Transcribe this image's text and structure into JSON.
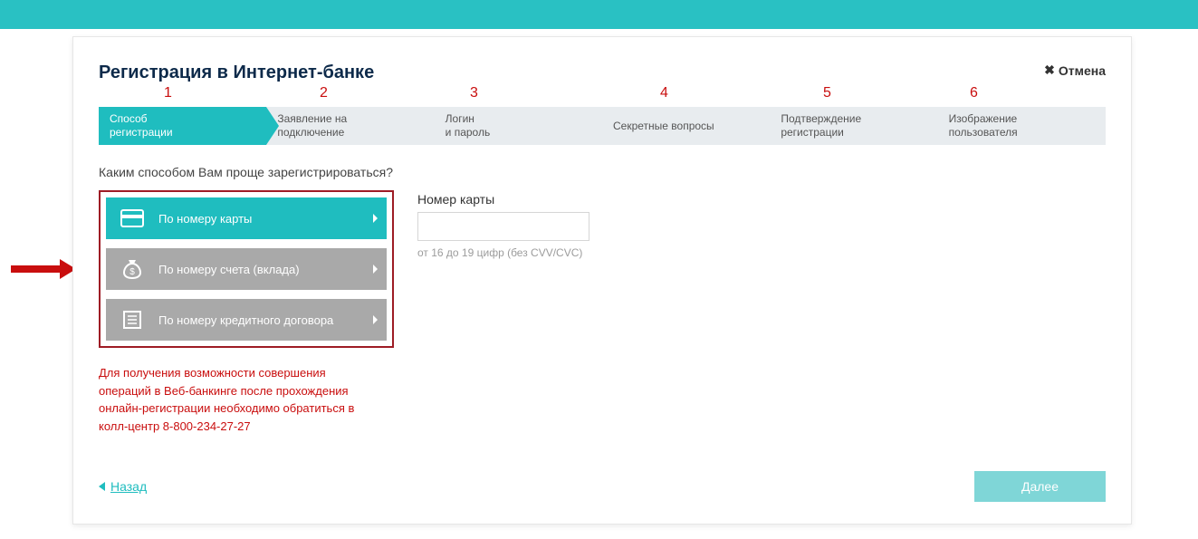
{
  "header": {
    "title": "Регистрация в Интернет-банке",
    "cancel_label": "Отмена"
  },
  "wizard": {
    "numbers": [
      "1",
      "2",
      "3",
      "4",
      "5",
      "6"
    ],
    "steps": [
      "Способ\nрегистрации",
      "Заявление на\nподключение",
      "Логин\nи пароль",
      "Секретные вопросы",
      "Подтверждение\nрегистрации",
      "Изображение\nпользователя"
    ]
  },
  "question": "Каким способом Вам проще зарегистрироваться?",
  "options": {
    "card": "По номеру карты",
    "account": "По номеру счета (вклада)",
    "credit": "По номеру кредитного договора"
  },
  "card_field": {
    "label": "Номер карты",
    "hint": "от 16 до 19 цифр (без CVV/CVC)",
    "value": ""
  },
  "notice": "Для получения возможности совершения операций в Веб-банкинге после прохождения онлайн-регистрации необходимо обратиться в колл-центр 8-800-234-27-27",
  "footer": {
    "back": "Назад",
    "next": "Далее"
  }
}
